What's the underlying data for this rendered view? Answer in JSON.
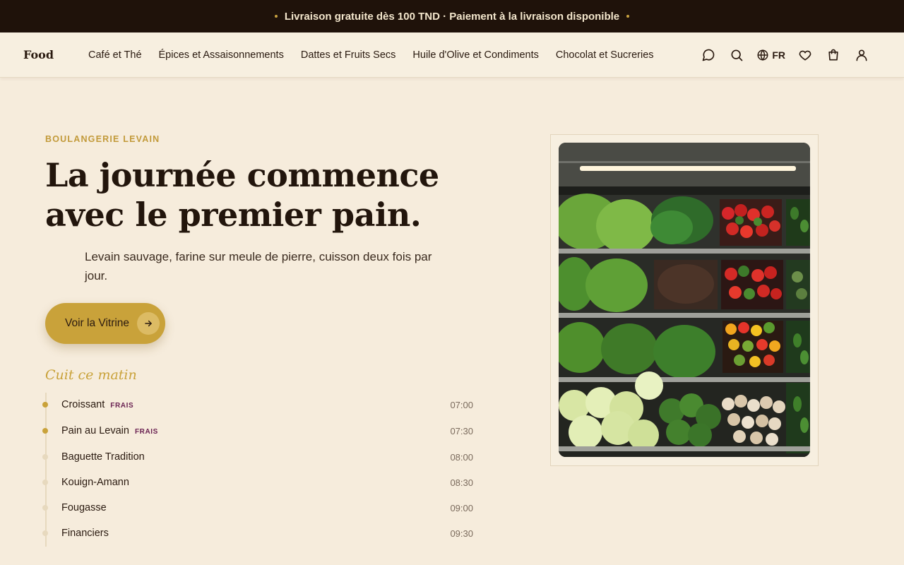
{
  "announcement": {
    "text": "Livraison gratuite dès 100 TND · Paiement à la livraison disponible"
  },
  "nav": {
    "logo": "Food",
    "menu": [
      "Café et Thé",
      "Épices et Assaisonnements",
      "Dattes et Fruits Secs",
      "Huile d'Olive et Condiments",
      "Chocolat et Sucreries"
    ],
    "icons": [
      "chat-icon",
      "search-icon",
      "globe-icon",
      "heart-icon",
      "cart-icon",
      "user-icon"
    ],
    "language": "FR"
  },
  "hero": {
    "eyebrow": "BOULANGERIE LEVAIN",
    "headline_line1": "La journée commence",
    "headline_line2": "avec le premier pain.",
    "lead": "Levain sauvage, farine sur meule de pierre, cuisson deux fois par jour.",
    "cta_label": "Voir la Vitrine"
  },
  "baked": {
    "title": "Cuit ce matin",
    "items": [
      {
        "name": "Croissant",
        "tag": "FRAIS",
        "time": "07:00",
        "active": true
      },
      {
        "name": "Pain au Levain",
        "tag": "FRAIS",
        "time": "07:30",
        "active": true
      },
      {
        "name": "Baguette Tradition",
        "tag": "",
        "time": "08:00",
        "active": false
      },
      {
        "name": "Kouign-Amann",
        "tag": "",
        "time": "08:30",
        "active": false
      },
      {
        "name": "Fougasse",
        "tag": "",
        "time": "09:00",
        "active": false
      },
      {
        "name": "Financiers",
        "tag": "",
        "time": "09:30",
        "active": false
      }
    ]
  },
  "colors": {
    "accent": "#c9a23a",
    "background": "#f6ecdc",
    "dark": "#1f120a",
    "tag": "#6a2252"
  }
}
